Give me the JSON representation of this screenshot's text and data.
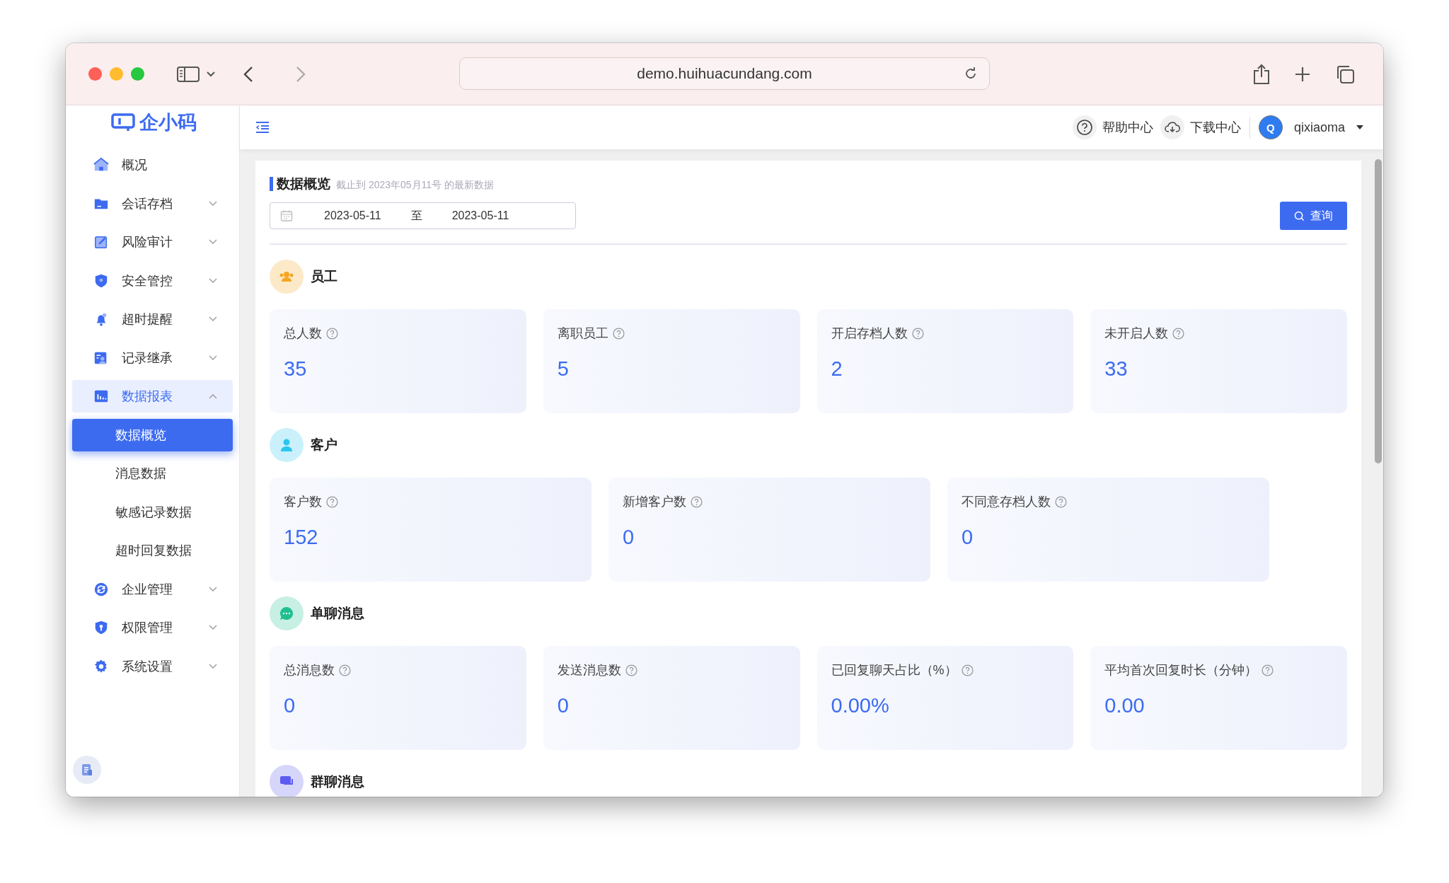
{
  "browser": {
    "url": "demo.huihuacundang.com"
  },
  "sidebar": {
    "logo": "企小码",
    "items": [
      {
        "label": "概况",
        "selected": false
      },
      {
        "label": "会话存档",
        "selected": false,
        "expanded": false
      },
      {
        "label": "风险审计",
        "selected": false,
        "expanded": false
      },
      {
        "label": "安全管控",
        "selected": false,
        "expanded": false
      },
      {
        "label": "超时提醒",
        "selected": false,
        "expanded": false
      },
      {
        "label": "记录继承",
        "selected": false,
        "expanded": false
      },
      {
        "label": "数据报表",
        "selected": true,
        "expanded": true,
        "children": [
          {
            "label": "数据概览",
            "selected": true
          },
          {
            "label": "消息数据",
            "selected": false
          },
          {
            "label": "敏感记录数据",
            "selected": false
          },
          {
            "label": "超时回复数据",
            "selected": false
          }
        ]
      },
      {
        "label": "企业管理",
        "selected": false,
        "expanded": false
      },
      {
        "label": "权限管理",
        "selected": false,
        "expanded": false
      },
      {
        "label": "系统设置",
        "selected": false,
        "expanded": false
      }
    ]
  },
  "header": {
    "help": "帮助中心",
    "download": "下载中心",
    "avatar": "Q",
    "user": "qixiaoma"
  },
  "overview": {
    "title": "数据概览",
    "subtitle": "截止到 2023年05月11号 的最新数据",
    "date_range": {
      "start": "2023-05-11",
      "separator": "至",
      "end": "2023-05-11"
    },
    "query_button": "查询",
    "sections": [
      {
        "title": "员工",
        "color": "#f5a623",
        "metrics": [
          {
            "label": "总人数",
            "value": "35"
          },
          {
            "label": "离职员工",
            "value": "5"
          },
          {
            "label": "开启存档人数",
            "value": "2"
          },
          {
            "label": "未开启人数",
            "value": "33"
          }
        ]
      },
      {
        "title": "客户",
        "color": "#2bc6f0",
        "metrics": [
          {
            "label": "客户数",
            "value": "152"
          },
          {
            "label": "新增客户数",
            "value": "0"
          },
          {
            "label": "不同意存档人数",
            "value": "0"
          }
        ]
      },
      {
        "title": "单聊消息",
        "color": "#1fbf8f",
        "metrics": [
          {
            "label": "总消息数",
            "value": "0"
          },
          {
            "label": "发送消息数",
            "value": "0"
          },
          {
            "label": "已回复聊天占比（%）",
            "value": "0.00%"
          },
          {
            "label": "平均首次回复时长（分钟）",
            "value": "0.00"
          }
        ]
      },
      {
        "title": "群聊消息",
        "color": "#5b5bf0"
      }
    ]
  }
}
